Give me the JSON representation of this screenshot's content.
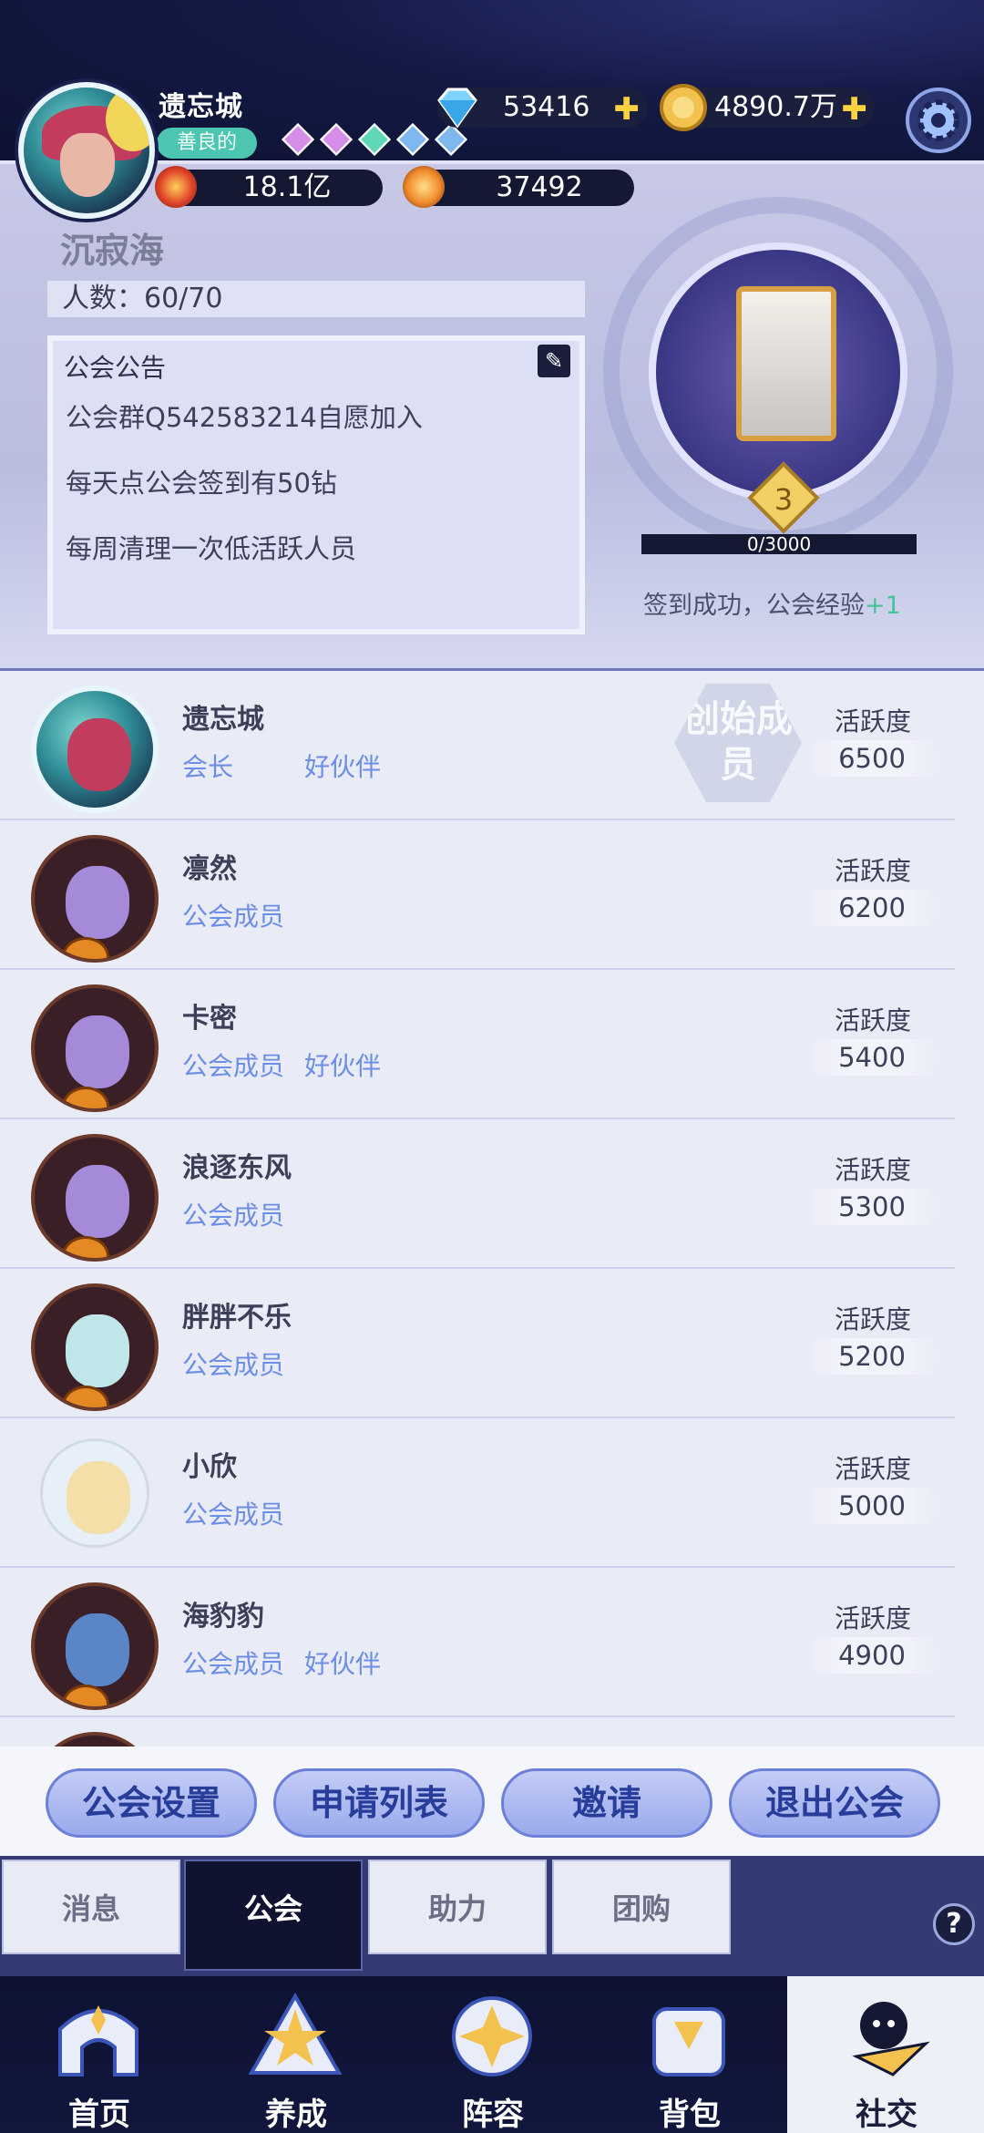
{
  "player": {
    "name": "遗忘城",
    "alignment": "善良的",
    "power": "18.1亿",
    "stars": "37492"
  },
  "currency": {
    "gems": "53416",
    "gold": "4890.7万"
  },
  "guild": {
    "name": "沉寂海",
    "member_count": "人数：60/70",
    "notice_title": "公会公告",
    "notice_lines": [
      "公会群Q542583214自愿加入",
      "每天点公会签到有50钻",
      "每周清理一次低活跃人员"
    ],
    "level": "3",
    "exp": "0/3000",
    "checkin_text": "签到成功，公会经验",
    "checkin_plus": "+1"
  },
  "members": [
    {
      "name": "遗忘城",
      "role": "会长",
      "partner": "好伙伴",
      "activity_label": "活跃度",
      "activity": "6500",
      "stamp": "创始成员"
    },
    {
      "name": "凛然",
      "role": "公会成员",
      "partner": "",
      "activity_label": "活跃度",
      "activity": "6200"
    },
    {
      "name": "卡密",
      "role": "公会成员",
      "partner": "好伙伴",
      "activity_label": "活跃度",
      "activity": "5400"
    },
    {
      "name": "浪逐东风",
      "role": "公会成员",
      "partner": "",
      "activity_label": "活跃度",
      "activity": "5300"
    },
    {
      "name": "胖胖不乐",
      "role": "公会成员",
      "partner": "",
      "activity_label": "活跃度",
      "activity": "5200"
    },
    {
      "name": "小欣",
      "role": "公会成员",
      "partner": "",
      "activity_label": "活跃度",
      "activity": "5000"
    },
    {
      "name": "海豹豹",
      "role": "公会成员",
      "partner": "好伙伴",
      "activity_label": "活跃度",
      "activity": "4900"
    }
  ],
  "actions": [
    "公会设置",
    "申请列表",
    "邀请",
    "退出公会"
  ],
  "tabs": [
    "消息",
    "公会",
    "助力",
    "团购"
  ],
  "help_label": "?",
  "nav": [
    "首页",
    "养成",
    "阵容",
    "背包",
    "社交"
  ],
  "colors": {
    "accent": "#6c8ee6",
    "active_tab": "#0f1330",
    "header": "#141a45"
  }
}
